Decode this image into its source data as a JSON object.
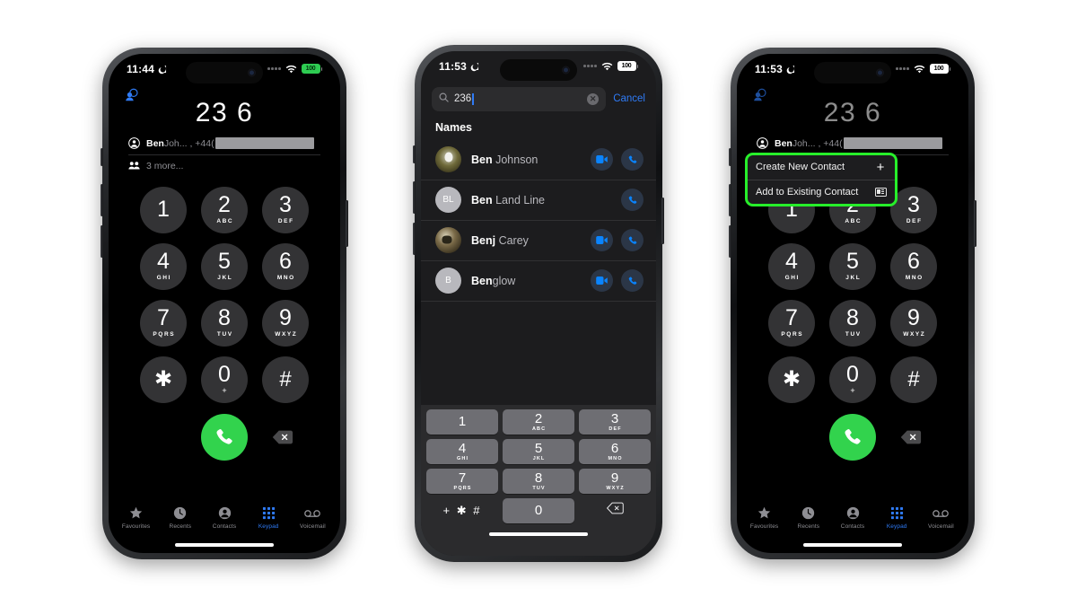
{
  "page": {
    "background": "#ffffff",
    "accent_blue": "#2f7bf6",
    "call_green": "#32d34d",
    "highlight_green": "#27ef2a"
  },
  "phones": [
    {
      "id": "phone-dialer",
      "status": {
        "time": "11:44",
        "dnd_icon": "moon-icon",
        "wifi_icon": "wifi-icon",
        "battery": "100"
      },
      "screen": "dialer",
      "dialer": {
        "add_contact_icon": "add-contact-icon",
        "number": "23 6",
        "suggestions": [
          {
            "icon": "contact-circle-icon",
            "bold": "Ben",
            "rest": "Joh... , +44(",
            "redacted": true
          },
          {
            "icon": "group-icon",
            "bold": "",
            "rest": "3 more...",
            "redacted": false
          }
        ]
      }
    },
    {
      "id": "phone-search",
      "status": {
        "time": "11:53",
        "dnd_icon": "moon-icon",
        "wifi_icon": "wifi-icon",
        "battery": "100"
      },
      "screen": "search",
      "search": {
        "icon": "search-icon",
        "value": "236",
        "placeholder": "Search",
        "clear_label": "✕",
        "cancel_label": "Cancel",
        "section_title": "Names",
        "results": [
          {
            "avatar_type": "photo",
            "bold": "Ben",
            "rest": " Johnson",
            "video": true,
            "call": true
          },
          {
            "avatar_type": "initials",
            "initials": "BL",
            "bold": "Ben",
            "rest": " Land Line",
            "video": false,
            "call": true
          },
          {
            "avatar_type": "photo",
            "bold": "Benj",
            "rest": " Carey",
            "video": true,
            "call": true
          },
          {
            "avatar_type": "initials",
            "initials": "B",
            "bold": "Ben",
            "rest": "glow",
            "video": true,
            "call": true
          }
        ]
      }
    },
    {
      "id": "phone-context-menu",
      "status": {
        "time": "11:53",
        "dnd_icon": "moon-icon",
        "wifi_icon": "wifi-icon",
        "battery": "100"
      },
      "screen": "dialer",
      "dialer": {
        "add_contact_icon": "add-contact-icon",
        "number": "23 6",
        "suggestions": [
          {
            "icon": "contact-circle-icon",
            "bold": "Ben",
            "rest": "Joh... , +44(",
            "redacted": true
          },
          {
            "icon": "group-icon",
            "bold": "",
            "rest": "3 more...",
            "redacted": false
          }
        ]
      },
      "context_menu": {
        "highlighted": true,
        "items": [
          {
            "label": "Create New Contact",
            "icon": "plus-icon"
          },
          {
            "label": "Add to Existing Contact",
            "icon": "contact-card-icon"
          }
        ]
      }
    }
  ],
  "keypad": {
    "keys": [
      {
        "digit": "1",
        "letters": ""
      },
      {
        "digit": "2",
        "letters": "ABC"
      },
      {
        "digit": "3",
        "letters": "DEF"
      },
      {
        "digit": "4",
        "letters": "GHI"
      },
      {
        "digit": "5",
        "letters": "JKL"
      },
      {
        "digit": "6",
        "letters": "MNO"
      },
      {
        "digit": "7",
        "letters": "PQRS"
      },
      {
        "digit": "8",
        "letters": "TUV"
      },
      {
        "digit": "9",
        "letters": "WXYZ"
      },
      {
        "digit": "✱",
        "letters": ""
      },
      {
        "digit": "0",
        "letters": "+"
      },
      {
        "digit": "#",
        "letters": ""
      }
    ],
    "call_button": "call-button",
    "delete_button": "delete-button"
  },
  "numeric_keyboard": {
    "rows": [
      [
        {
          "d": "1",
          "l": ""
        },
        {
          "d": "2",
          "l": "ABC"
        },
        {
          "d": "3",
          "l": "DEF"
        }
      ],
      [
        {
          "d": "4",
          "l": "GHI"
        },
        {
          "d": "5",
          "l": "JKL"
        },
        {
          "d": "6",
          "l": "MNO"
        }
      ],
      [
        {
          "d": "7",
          "l": "PQRS"
        },
        {
          "d": "8",
          "l": "TUV"
        },
        {
          "d": "9",
          "l": "WXYZ"
        }
      ]
    ],
    "sym_key": "+ ✱ #",
    "zero_key": "0",
    "backspace": "backspace-icon"
  },
  "tabbar": {
    "items": [
      {
        "label": "Favourites",
        "icon": "star-icon",
        "active": false
      },
      {
        "label": "Recents",
        "icon": "clock-icon",
        "active": false
      },
      {
        "label": "Contacts",
        "icon": "person-icon",
        "active": false
      },
      {
        "label": "Keypad",
        "icon": "keypad-grid-icon",
        "active": true
      },
      {
        "label": "Voicemail",
        "icon": "voicemail-icon",
        "active": false
      }
    ]
  }
}
